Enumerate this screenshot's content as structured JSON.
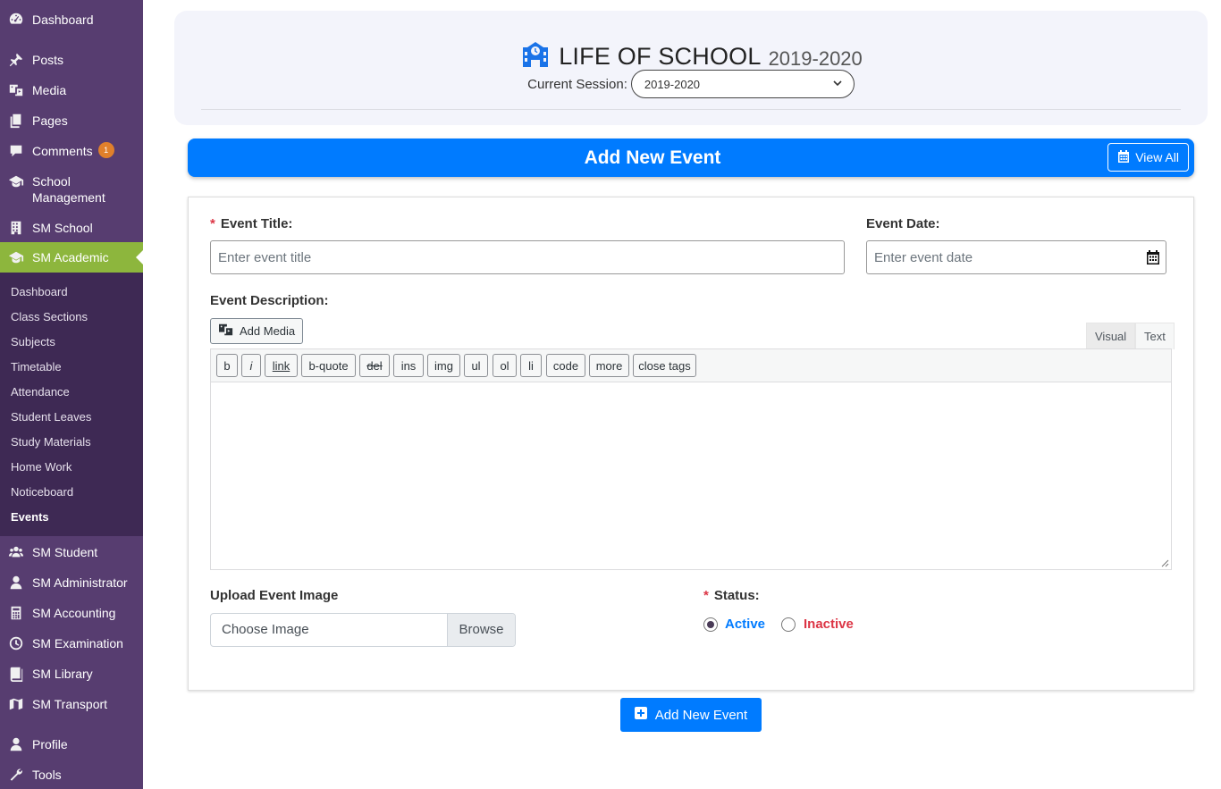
{
  "sidebar": {
    "menu": [
      {
        "label": "Dashboard",
        "icon": "dashboard-icon"
      },
      {
        "label": "Posts",
        "icon": "pin-icon"
      },
      {
        "label": "Media",
        "icon": "media-icon"
      },
      {
        "label": "Pages",
        "icon": "pages-icon"
      },
      {
        "label": "Comments",
        "icon": "comment-icon",
        "badge": "1"
      },
      {
        "label": "School",
        "label2": "Management",
        "icon": "graduation-cap-icon"
      },
      {
        "label": "SM School",
        "icon": "building-icon"
      },
      {
        "label": "SM Academic",
        "icon": "graduation-cap-icon",
        "active": true
      },
      {
        "label": "SM Student",
        "icon": "users-icon"
      },
      {
        "label": "SM Administrator",
        "icon": "admin-user-icon"
      },
      {
        "label": "SM Accounting",
        "icon": "calculator-icon"
      },
      {
        "label": "SM Examination",
        "icon": "clock-icon"
      },
      {
        "label": "SM Library",
        "icon": "book-icon"
      },
      {
        "label": "SM Transport",
        "icon": "map-icon"
      },
      {
        "label": "Profile",
        "icon": "user-icon"
      },
      {
        "label": "Tools",
        "icon": "wrench-icon"
      }
    ],
    "submenu": [
      "Dashboard",
      "Class Sections",
      "Subjects",
      "Timetable",
      "Attendance",
      "Student Leaves",
      "Study Materials",
      "Home Work",
      "Noticeboard",
      "Events"
    ],
    "current_submenu": "Events",
    "colors": {
      "background": "#573d70",
      "submenu_background": "#3e2954",
      "active": "#8db63d"
    }
  },
  "header": {
    "title": "LIFE OF SCHOOL",
    "year": "2019-2020",
    "icon": "school-icon",
    "session_label": "Current Session:",
    "session_value": "2019-2020"
  },
  "title_bar": {
    "title": "Add New Event",
    "view_all_label": "View All",
    "color": "#007bff"
  },
  "form": {
    "required_marker": "*",
    "event_title_label": "Event Title:",
    "event_title_placeholder": "Enter event title",
    "event_date_label": "Event Date:",
    "event_date_placeholder": "Enter event date",
    "description_label": "Event Description:",
    "add_media_label": "Add Media",
    "editor_tabs": [
      "Visual",
      "Text"
    ],
    "active_editor_tab": "Text",
    "quicktags": [
      "b",
      "i",
      "link",
      "b-quote",
      "del",
      "ins",
      "img",
      "ul",
      "ol",
      "li",
      "code",
      "more",
      "close tags"
    ],
    "upload_label": "Upload Event Image",
    "file_placeholder": "Choose Image",
    "browse_label": "Browse",
    "status_label": "Status:",
    "status_options": [
      {
        "label": "Active",
        "checked": true,
        "color": "#007bff"
      },
      {
        "label": "Inactive",
        "checked": false,
        "color": "#dc3545"
      }
    ],
    "submit_label": "Add New Event"
  }
}
